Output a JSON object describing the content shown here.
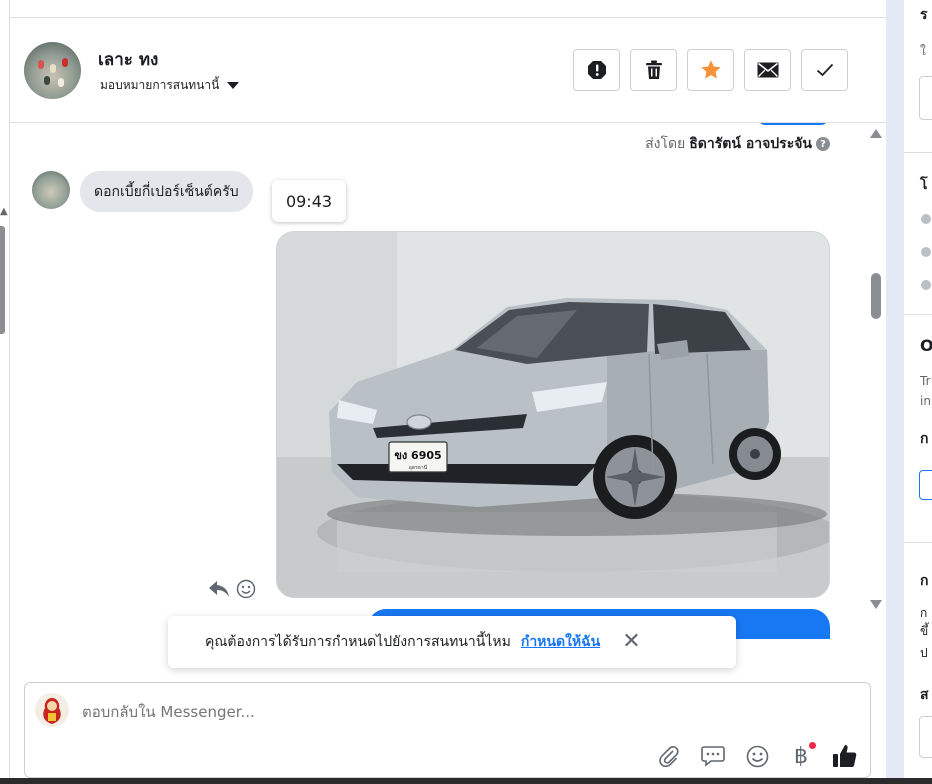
{
  "header": {
    "contact_name": "เลาะ ทง",
    "assign_label": "มอบหมายการสนทนานี้",
    "actions": [
      {
        "name": "mark-spam-button",
        "icon": "alert-icon"
      },
      {
        "name": "delete-button",
        "icon": "trash-icon"
      },
      {
        "name": "star-button",
        "icon": "star-icon"
      },
      {
        "name": "mark-unread-button",
        "icon": "envelope-icon"
      },
      {
        "name": "mark-done-button",
        "icon": "check-icon"
      }
    ]
  },
  "chat": {
    "sent_by_prefix": "ส่งโดย",
    "sent_by_name": "ธิดารัตน์ อาจประจัน",
    "help_glyph": "?",
    "incoming_message": "ดอกเบี้ยกี่เปอร์เซ็นต์ครับ",
    "time_tooltip": "09:43",
    "photo_plate": "ขง 6905",
    "photo_plate_sub": "อุดรธานี"
  },
  "assign_toast": {
    "text": "คุณต้องการได้รับการกำหนดไปยังการสนทนานี้ไหม",
    "link": "กำหนดให้ฉัน",
    "close": "✕"
  },
  "composer": {
    "placeholder": "ตอบกลับใน Messenger...",
    "baht_glyph": "฿"
  },
  "right_panel": {
    "line1": "ร",
    "line2": "ใ",
    "heading2": "โ",
    "heading3": "O",
    "text3a": "Tr",
    "text3b": "in",
    "heading4": "ก",
    "heading5": "ก",
    "text5a": "ก",
    "text5b": "ขึ้",
    "text5c": "ป",
    "heading6": "ส"
  },
  "colors": {
    "accent": "#1877f2",
    "star": "#f7923a",
    "bubble": "#e4e6eb",
    "notification": "#f02849"
  }
}
